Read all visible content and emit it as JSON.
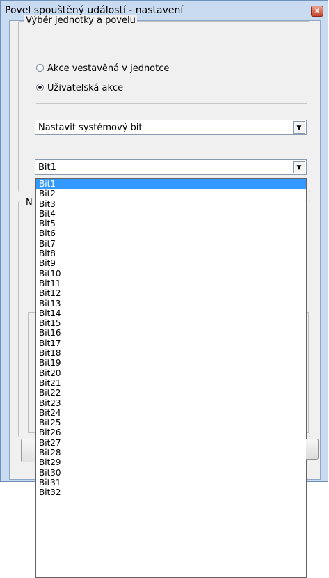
{
  "window": {
    "title": "Povel spouštěný událostí - nastavení",
    "close_glyph": "x"
  },
  "unit_group": {
    "legend": "Výběr jednotky a povelu",
    "options": [
      {
        "label": "Akce vestavěná v jednotce",
        "checked": false
      },
      {
        "label": "Uživatelská akce",
        "checked": true
      }
    ]
  },
  "action_select": {
    "value": "Nastavit systémový bit",
    "arrow_icon": "dropdown-arrow-icon"
  },
  "bit_select": {
    "value": "Bit1",
    "arrow_icon": "dropdown-arrow-icon",
    "options": [
      "Bit1",
      "Bit2",
      "Bit3",
      "Bit4",
      "Bit5",
      "Bit6",
      "Bit7",
      "Bit8",
      "Bit9",
      "Bit10",
      "Bit11",
      "Bit12",
      "Bit13",
      "Bit14",
      "Bit15",
      "Bit16",
      "Bit17",
      "Bit18",
      "Bit19",
      "Bit20",
      "Bit21",
      "Bit22",
      "Bit23",
      "Bit24",
      "Bit25",
      "Bit26",
      "Bit27",
      "Bit28",
      "Bit29",
      "Bit30",
      "Bit31",
      "Bit32"
    ],
    "selected_index": 0
  },
  "second_group": {
    "legend_partial": "N"
  },
  "colors": {
    "selection": "#3399ff",
    "dialog_frame": "#c9dbf0",
    "client_bg": "#f0f0f0"
  }
}
